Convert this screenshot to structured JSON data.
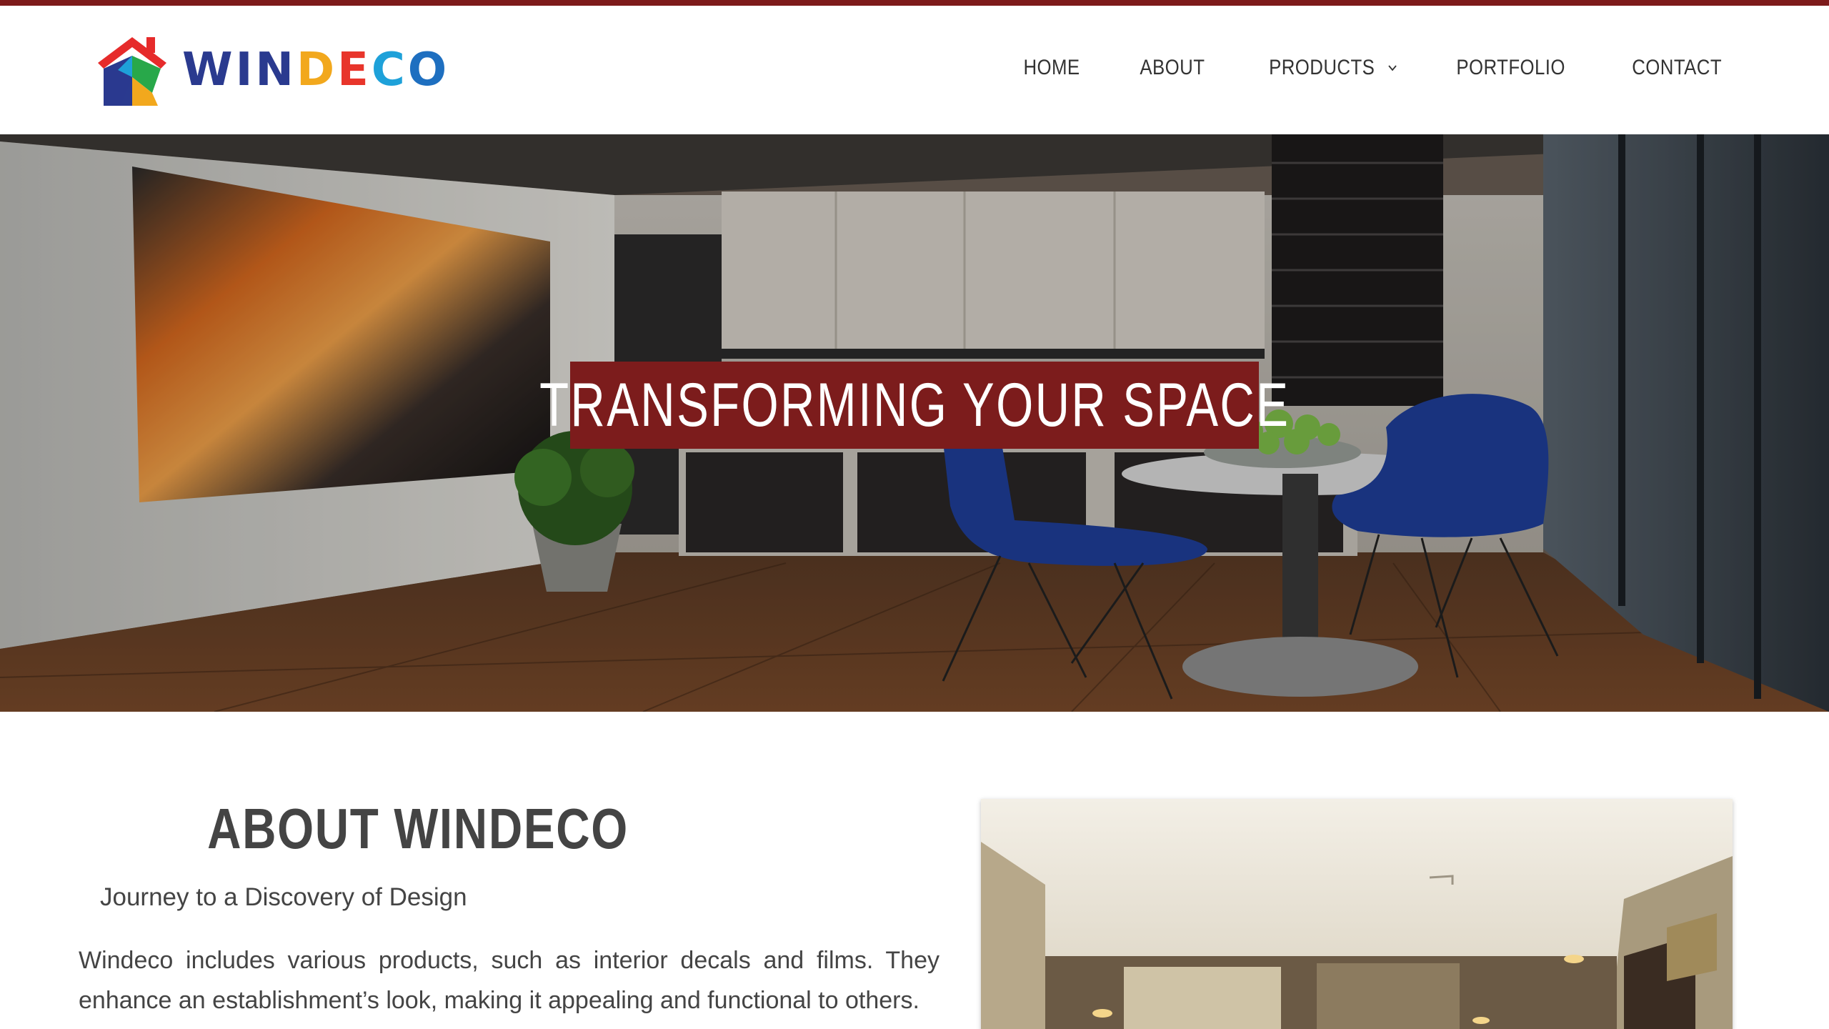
{
  "brand": {
    "name": "WINDECO",
    "letters": [
      "W",
      "I",
      "N",
      "D",
      "E",
      "C",
      "O"
    ],
    "letter_colors": [
      "#2a3a8f",
      "#2a3a8f",
      "#2a3a8f",
      "#f2a81d",
      "#e8352b",
      "#1ea1d9",
      "#1e6fc0"
    ],
    "accent": "#7d1a1a"
  },
  "nav": {
    "items": [
      {
        "label": "HOME"
      },
      {
        "label": "ABOUT"
      },
      {
        "label": "PRODUCTS",
        "has_dropdown": true
      },
      {
        "label": "PORTFOLIO"
      },
      {
        "label": "CONTACT"
      }
    ]
  },
  "hero": {
    "title": "TRANSFORMING YOUR SPACE",
    "banner_color": "#7c1c1c"
  },
  "about": {
    "title": "ABOUT WINDECO",
    "subtitle": "Journey to a Discovery of Design",
    "body": "Windeco includes various products, such as interior decals and films. They enhance an establishment’s look, making it appealing and functional to others."
  }
}
